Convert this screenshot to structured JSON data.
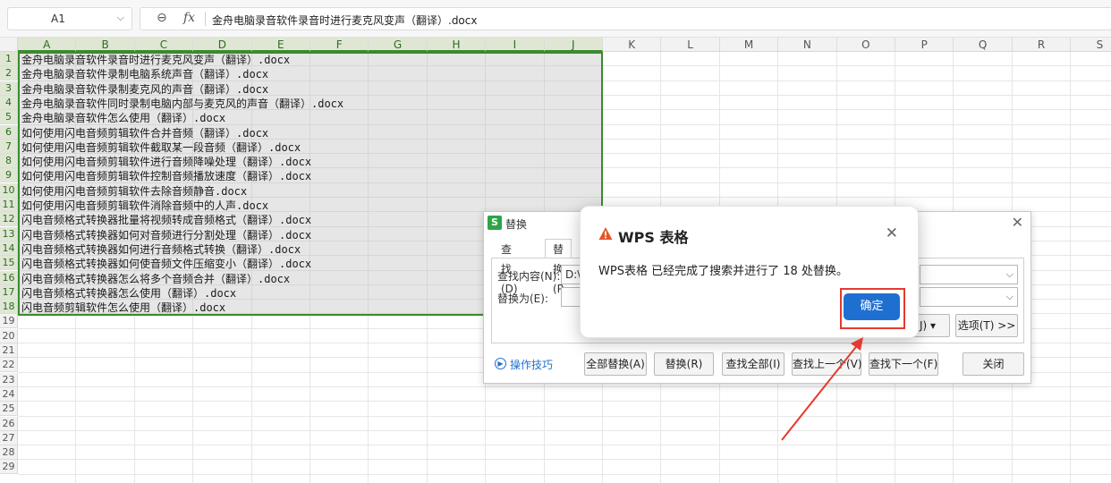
{
  "formula_bar": {
    "cell_ref": "A1",
    "content": "金舟电脑录音软件录音时进行麦克风变声（翻译）.docx"
  },
  "sheet": {
    "columns": [
      "A",
      "B",
      "C",
      "D",
      "E",
      "F",
      "G",
      "H",
      "I",
      "J",
      "K",
      "L",
      "M",
      "N",
      "O",
      "P",
      "Q",
      "R",
      "S"
    ],
    "rows": [
      "1",
      "2",
      "3",
      "4",
      "5",
      "6",
      "7",
      "8",
      "9",
      "10",
      "11",
      "12",
      "13",
      "14",
      "15",
      "16",
      "17",
      "18",
      "19",
      "20",
      "21",
      "22",
      "23",
      "24",
      "25",
      "26",
      "27",
      "28",
      "29"
    ],
    "cells": [
      "金舟电脑录音软件录音时进行麦克风变声（翻译）.docx",
      "金舟电脑录音软件录制电脑系统声音（翻译）.docx",
      "金舟电脑录音软件录制麦克风的声音（翻译）.docx",
      "金舟电脑录音软件同时录制电脑内部与麦克风的声音（翻译）.docx",
      "金舟电脑录音软件怎么使用（翻译）.docx",
      "如何使用闪电音频剪辑软件合并音频（翻译）.docx",
      "如何使用闪电音频剪辑软件截取某一段音频（翻译）.docx",
      "如何使用闪电音频剪辑软件进行音频降噪处理（翻译）.docx",
      "如何使用闪电音频剪辑软件控制音频播放速度（翻译）.docx",
      "如何使用闪电音频剪辑软件去除音频静音.docx",
      "如何使用闪电音频剪辑软件消除音频中的人声.docx",
      "闪电音频格式转换器批量将视频转成音频格式（翻译）.docx",
      "闪电音频格式转换器如何对音频进行分割处理（翻译）.docx",
      "闪电音频格式转换器如何进行音频格式转换（翻译）.docx",
      "闪电音频格式转换器如何使音频文件压缩变小（翻译）.docx",
      "闪电音频格式转换器怎么将多个音频合并（翻译）.docx",
      "闪电音频格式转换器怎么使用（翻译）.docx",
      "闪电音频剪辑软件怎么使用（翻译）.docx"
    ]
  },
  "replace_dialog": {
    "title": "替换",
    "tabs": [
      "查找(D)",
      "替换(P"
    ],
    "find_label": "查找内容(N):",
    "find_value": "D:\\",
    "replace_label": "替换为(E):",
    "replace_value": "",
    "format_btn": "J) ▾",
    "options_btn": "选项(T) >>",
    "tips_link": "操作技巧",
    "buttons": {
      "replace_all": "全部替换(A)",
      "replace": "替换(R)",
      "find_all": "查找全部(I)",
      "find_prev": "查找上一个(V)",
      "find_next": "查找下一个(F)",
      "close": "关闭"
    }
  },
  "message_box": {
    "title": "WPS 表格",
    "message": "WPS表格 已经完成了搜索并进行了 18 处替换。",
    "ok": "确定"
  },
  "colors": {
    "selection_border": "#3c8a2e",
    "ok_button": "#1f6fd1",
    "highlight": "#e53a2f",
    "warning": "#e8542a"
  }
}
